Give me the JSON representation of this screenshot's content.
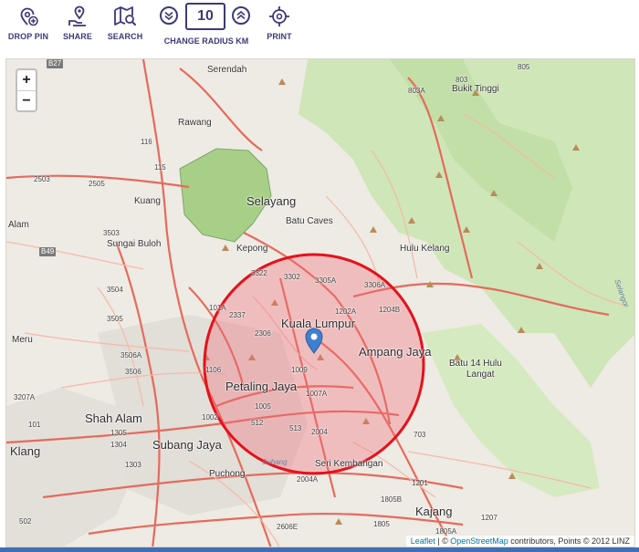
{
  "toolbar": {
    "drop_pin": "DROP PIN",
    "share": "SHARE",
    "search": "SEARCH",
    "change_radius": "CHANGE RADIUS KM",
    "radius_value": "10",
    "print": "PRINT"
  },
  "colors": {
    "brand": "#3b3a78",
    "circle_stroke": "#e3121b",
    "circle_fill": "#f06a78",
    "pin": "#3f7fcf",
    "bottom_bar": "#3f6fb5"
  },
  "map": {
    "zoom_in": "+",
    "zoom_out": "−",
    "places": {
      "serendah": "Serendah",
      "bukit_tinggi": "Bukit Tinggi",
      "rawang": "Rawang",
      "kuang": "Kuang",
      "selayang": "Selayang",
      "batu_caves": "Batu Caves",
      "alam": "Alam",
      "sungai_buloh": "Sungai Buloh",
      "kepong": "Kepong",
      "hulu_kelang": "Hulu Kelang",
      "meru": "Meru",
      "kuala_lumpur": "Kuala Lumpur",
      "ampang_jaya": "Ampang Jaya",
      "batu_14_hulu": "Batu 14 Hulu",
      "langat": "Langat",
      "petaling_jaya": "Petaling Jaya",
      "shah_alam": "Shah Alam",
      "subang_jaya": "Subang Jaya",
      "klang": "Klang",
      "puchong": "Puchong",
      "seri_kembangan": "Seri Kembangan",
      "kajang": "Kajang",
      "sungai_buloh_river": "Subang",
      "selangor_river": "Selangor"
    },
    "routes": {
      "b27": "B27",
      "r805": "805",
      "r803": "803",
      "r803a": "803A",
      "r116": "116",
      "r115": "115",
      "r2503": "2503",
      "r2505": "2505",
      "r3503": "3503",
      "b49": "B49",
      "r3322": "3322",
      "r3302": "3302",
      "r3305a": "3305A",
      "r3306a": "3306A",
      "r1202a": "1202A",
      "r1204b": "1204B",
      "r2337": "2337",
      "r101a": "101A",
      "r3504": "3504",
      "r3505": "3505",
      "r3506a": "3506A",
      "r3506": "3506",
      "r3207a": "3207A",
      "r2306": "2306",
      "r1106": "1106",
      "r1009": "1009",
      "r1007a": "1007A",
      "r1005": "1005",
      "r1002": "1002",
      "r512": "512",
      "r513": "513",
      "r2004": "2004",
      "r101": "101",
      "r1305": "1305",
      "r1304": "1304",
      "r1303": "1303",
      "r703": "703",
      "r2004a": "2004A",
      "r2606e": "2606E",
      "r502": "502",
      "r1805a": "1805A",
      "r1805": "1805",
      "r1201": "1201",
      "r1207": "1207",
      "r1805b": "1805B"
    },
    "attribution": {
      "leaflet": "Leaflet",
      "sep": " | © ",
      "osm": "OpenStreetMap",
      "rest": " contributors, Points © 2012 LINZ"
    }
  }
}
